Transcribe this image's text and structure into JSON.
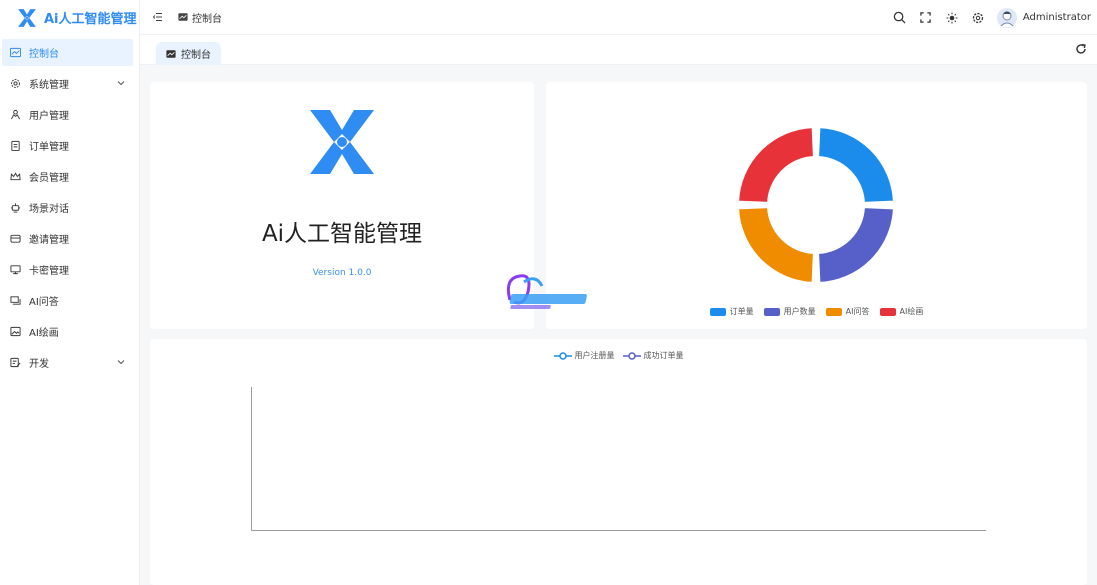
{
  "app": {
    "brand": "Ai人工智能管理"
  },
  "sidebar": {
    "items": [
      {
        "label": "控制台",
        "icon": "dashboard-icon"
      },
      {
        "label": "系统管理",
        "icon": "gear-icon"
      },
      {
        "label": "用户管理",
        "icon": "users-icon"
      },
      {
        "label": "订单管理",
        "icon": "orders-icon"
      },
      {
        "label": "会员管理",
        "icon": "crown-icon"
      },
      {
        "label": "场景对话",
        "icon": "robot-icon"
      },
      {
        "label": "邀请管理",
        "icon": "invite-icon"
      },
      {
        "label": "卡密管理",
        "icon": "card-icon"
      },
      {
        "label": "AI问答",
        "icon": "chat-icon"
      },
      {
        "label": "AI绘画",
        "icon": "image-icon"
      },
      {
        "label": "开发",
        "icon": "dev-icon"
      }
    ]
  },
  "header": {
    "breadcrumb": "控制台",
    "username": "Administrator",
    "icons": [
      "search-icon",
      "fullscreen-icon",
      "theme-sun-icon",
      "settings-icon"
    ]
  },
  "tabs": [
    {
      "label": "控制台"
    }
  ],
  "info_card": {
    "title": "Ai人工智能管理",
    "version": "Version 1.0.0"
  },
  "colors": {
    "accent": "#2d8cf0",
    "series_1": "#1b8ceb",
    "series_2": "#5660c8",
    "series_3": "#f08c00",
    "series_4": "#e8323a",
    "logo": "#2f8cf3"
  },
  "chart_data": [
    {
      "type": "pie",
      "variant": "nightingale-ring",
      "title": "",
      "series": [
        {
          "name": "订单量",
          "value": 1,
          "color": "#1b8ceb"
        },
        {
          "name": "用户数量",
          "value": 1,
          "color": "#5660c8"
        },
        {
          "name": "AI问答",
          "value": 1,
          "color": "#f08c00"
        },
        {
          "name": "AI绘画",
          "value": 1,
          "color": "#e8323a"
        }
      ],
      "legend_position": "bottom"
    },
    {
      "type": "line",
      "title": "",
      "series": [
        {
          "name": "用户注册量",
          "values": [],
          "color": "#1b8ceb"
        },
        {
          "name": "成功订单量",
          "values": [],
          "color": "#5660c8"
        }
      ],
      "legend_position": "top"
    }
  ]
}
